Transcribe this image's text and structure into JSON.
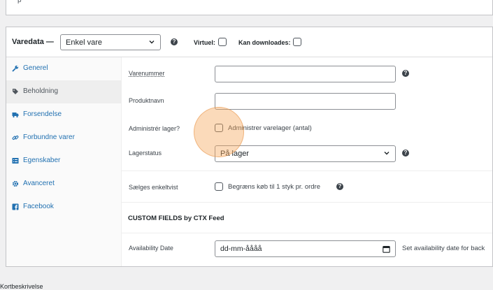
{
  "top_field": {
    "value": "p"
  },
  "header": {
    "title": "Varedata —",
    "product_type": {
      "selected": "Enkel vare"
    },
    "virtual_label": "Virtuel:",
    "downloadable_label": "Kan downloades:"
  },
  "sidebar": {
    "items": [
      {
        "label": "Generel",
        "icon": "wrench-icon",
        "active": false
      },
      {
        "label": "Beholdning",
        "icon": "tag-icon",
        "active": true
      },
      {
        "label": "Forsendelse",
        "icon": "truck-icon",
        "active": false
      },
      {
        "label": "Forbundne varer",
        "icon": "link-icon",
        "active": false
      },
      {
        "label": "Egenskaber",
        "icon": "list-icon",
        "active": false
      },
      {
        "label": "Avanceret",
        "icon": "gear-icon",
        "active": false
      },
      {
        "label": "Facebook",
        "icon": "facebook-icon",
        "active": false
      }
    ]
  },
  "inventory": {
    "sku_label": "Varenummer",
    "sku_value": "",
    "name_label": "Produktnavn",
    "name_value": "",
    "manage_stock_label": "Administrér lager?",
    "manage_stock_text": "Administrer varelager (antal)",
    "stock_status_label": "Lagerstatus",
    "stock_status_value": "På lager",
    "sold_individually_label": "Sælges enkeltvist",
    "sold_individually_text": "Begræns køb til 1 styk pr. ordre"
  },
  "custom_fields": {
    "title": "CUSTOM FIELDS by CTX Feed",
    "availability_label": "Availability Date",
    "availability_placeholder": "dd-mm-åååå",
    "availability_hint": "Set availability date for back"
  },
  "footer": {
    "text": "Kortbeskrivelse"
  },
  "colors": {
    "link": "#2271b1",
    "border": "#8c8f94",
    "cursor_highlight": "#f5a65a"
  }
}
